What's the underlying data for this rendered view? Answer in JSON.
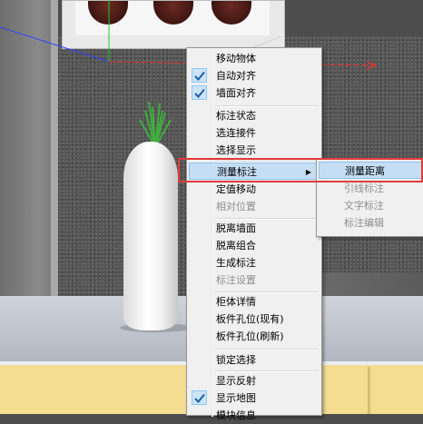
{
  "colors": {
    "highlight": "#c5def5",
    "annotation_red": "#e23a3a",
    "axis_red": "#ff2a2a",
    "axis_green": "#22cc22",
    "axis_blue": "#3344ff"
  },
  "context_menu": {
    "items": [
      {
        "label": "移动物体",
        "checked": false,
        "disabled": false
      },
      {
        "label": "自动对齐",
        "checked": true,
        "disabled": false
      },
      {
        "label": "墙面对齐",
        "checked": true,
        "disabled": false
      },
      {
        "label": "标注状态",
        "checked": false,
        "disabled": false
      },
      {
        "label": "选连接件",
        "checked": false,
        "disabled": false
      },
      {
        "label": "选择显示",
        "checked": false,
        "disabled": false
      },
      {
        "label": "测量标注",
        "checked": false,
        "disabled": false,
        "highlighted": true,
        "has_submenu": true
      },
      {
        "label": "定值移动",
        "checked": false,
        "disabled": false
      },
      {
        "label": "相对位置",
        "checked": false,
        "disabled": true
      },
      {
        "label": "脱离墙面",
        "checked": false,
        "disabled": false
      },
      {
        "label": "脱离组合",
        "checked": false,
        "disabled": false
      },
      {
        "label": "生成标注",
        "checked": false,
        "disabled": false
      },
      {
        "label": "标注设置",
        "checked": false,
        "disabled": true
      },
      {
        "label": "柜体详情",
        "checked": false,
        "disabled": false
      },
      {
        "label": "板件孔位(现有)",
        "checked": false,
        "disabled": false
      },
      {
        "label": "板件孔位(刷新)",
        "checked": false,
        "disabled": false
      },
      {
        "label": "锁定选择",
        "checked": false,
        "disabled": false
      },
      {
        "label": "显示反射",
        "checked": false,
        "disabled": false
      },
      {
        "label": "显示地图",
        "checked": true,
        "disabled": false
      },
      {
        "label": "模块信息",
        "checked": false,
        "disabled": false
      }
    ]
  },
  "submenu": {
    "items": [
      {
        "label": "测量距离",
        "disabled": false,
        "highlighted": true
      },
      {
        "label": "引线标注",
        "disabled": true
      },
      {
        "label": "文字标注",
        "disabled": true
      },
      {
        "label": "标注编辑",
        "disabled": true
      }
    ]
  }
}
